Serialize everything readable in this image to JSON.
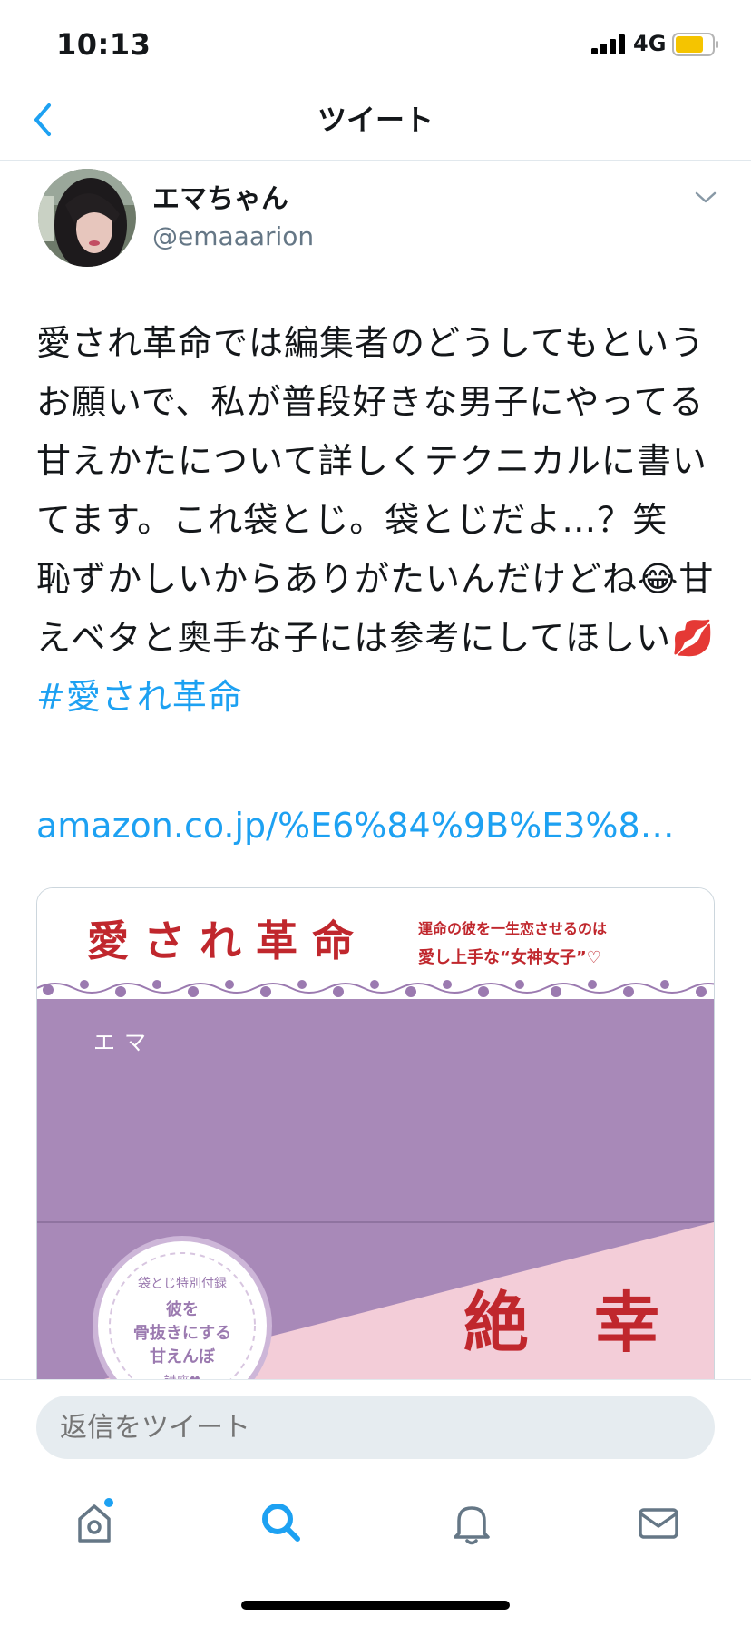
{
  "status_bar": {
    "time": "10:13",
    "network": "4G"
  },
  "header": {
    "title": "ツイート"
  },
  "tweet": {
    "author_name": "エマちゃん",
    "author_handle": "@emaaarion",
    "text_main": "愛され革命では編集者のどうしてもというお願いで、私が普段好きな男子にやってる甘えかたについて詳しくテクニカルに書いてます。これ袋とじ。袋とじだよ…？笑　恥ずかしいからありがたいんだけどね😂甘えベタと奥手な子には参考にしてほしい💋",
    "hashtag": "#愛され革命",
    "link": "amazon.co.jp/%E6%84%9B%E3%8…"
  },
  "card": {
    "book_title": "愛 さ れ 革 命",
    "tagline_1": "運命の彼を一生恋させるのは",
    "tagline_2": "愛し上手な“女神女子”♡",
    "author": "エマ",
    "badge_1": "袋とじ特別付録",
    "badge_2": "彼を",
    "badge_3": "骨抜きにする",
    "badge_4": "甘えんぼ",
    "badge_5": "講座♥",
    "red_text": "絶　幸"
  },
  "reply": {
    "placeholder": "返信をツイート"
  },
  "tabs": [
    {
      "icon": "home-icon"
    },
    {
      "icon": "search-icon"
    },
    {
      "icon": "bell-icon"
    },
    {
      "icon": "mail-icon"
    }
  ],
  "colors": {
    "accent": "#1da1f2",
    "cover_purple": "#a889b8",
    "cover_pink": "#f3cdd8",
    "cover_red": "#c0272d"
  }
}
